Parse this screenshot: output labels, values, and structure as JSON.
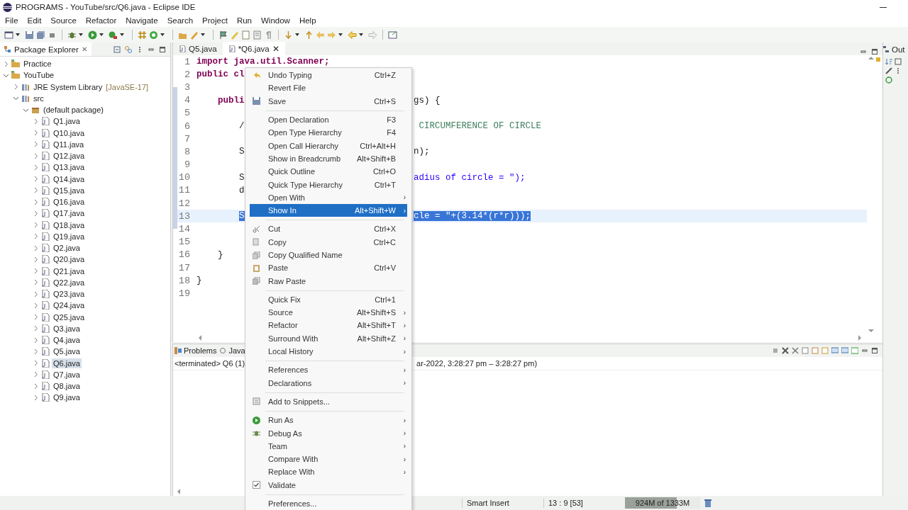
{
  "window": {
    "title": "PROGRAMS - YouTube/src/Q6.java - Eclipse IDE"
  },
  "menubar": [
    "File",
    "Edit",
    "Source",
    "Refactor",
    "Navigate",
    "Search",
    "Project",
    "Run",
    "Window",
    "Help"
  ],
  "package_explorer": {
    "tab": {
      "label": "Package Explorer",
      "close": "✕",
      "selected": true
    },
    "tree": [
      {
        "label": "Practice",
        "expanded": false
      },
      {
        "label": "YouTube",
        "expanded": true,
        "children": [
          {
            "label": "JRE System Library",
            "decoration": "[JavaSE-17]",
            "expanded": false
          },
          {
            "label": "src",
            "expanded": true,
            "children": [
              {
                "label": "(default package)",
                "expanded": true,
                "children": [
                  {
                    "label": "Q1.java",
                    "expanded": false,
                    "selected": false
                  },
                  {
                    "label": "Q10.java",
                    "expanded": false,
                    "selected": false
                  },
                  {
                    "label": "Q11.java",
                    "expanded": false,
                    "selected": false
                  },
                  {
                    "label": "Q12.java",
                    "expanded": false,
                    "selected": false
                  },
                  {
                    "label": "Q13.java",
                    "expanded": false,
                    "selected": false
                  },
                  {
                    "label": "Q14.java",
                    "expanded": false,
                    "selected": false
                  },
                  {
                    "label": "Q15.java",
                    "expanded": false,
                    "selected": false
                  },
                  {
                    "label": "Q16.java",
                    "expanded": false,
                    "selected": false
                  },
                  {
                    "label": "Q17.java",
                    "expanded": false,
                    "selected": false
                  },
                  {
                    "label": "Q18.java",
                    "expanded": false,
                    "selected": false
                  },
                  {
                    "label": "Q19.java",
                    "expanded": false,
                    "selected": false
                  },
                  {
                    "label": "Q2.java",
                    "expanded": false,
                    "selected": false
                  },
                  {
                    "label": "Q20.java",
                    "expanded": false,
                    "selected": false
                  },
                  {
                    "label": "Q21.java",
                    "expanded": false,
                    "selected": false
                  },
                  {
                    "label": "Q22.java",
                    "expanded": false,
                    "selected": false
                  },
                  {
                    "label": "Q23.java",
                    "expanded": false,
                    "selected": false
                  },
                  {
                    "label": "Q24.java",
                    "expanded": false,
                    "selected": false
                  },
                  {
                    "label": "Q25.java",
                    "expanded": false,
                    "selected": false
                  },
                  {
                    "label": "Q3.java",
                    "expanded": false,
                    "selected": false
                  },
                  {
                    "label": "Q4.java",
                    "expanded": false,
                    "selected": false
                  },
                  {
                    "label": "Q5.java",
                    "expanded": false,
                    "selected": false
                  },
                  {
                    "label": "Q6.java",
                    "expanded": false,
                    "selected": true
                  },
                  {
                    "label": "Q7.java",
                    "expanded": false,
                    "selected": false
                  },
                  {
                    "label": "Q8.java",
                    "expanded": false,
                    "selected": false
                  },
                  {
                    "label": "Q9.java",
                    "expanded": false,
                    "selected": false
                  }
                ]
              }
            ]
          }
        ]
      }
    ]
  },
  "editor": {
    "tabs": [
      {
        "label": "Q5.java",
        "selected": false
      },
      {
        "label": "*Q6.java",
        "close": "✕",
        "selected": true
      }
    ],
    "lines": [
      {
        "number": "1",
        "left": "import java.util.Scanner;",
        "selected": false
      },
      {
        "number": "2",
        "left": "public cl",
        "selected": false
      },
      {
        "number": "3",
        "selected": false
      },
      {
        "number": "4",
        "left": "    publi",
        "right": "gs) {",
        "selected": false
      },
      {
        "number": "5",
        "selected": false
      },
      {
        "number": "6",
        "left": "        /",
        "right": " CIRCUMFERENCE OF CIRCLE",
        "kind": "comment",
        "selected": false
      },
      {
        "number": "7",
        "selected": false
      },
      {
        "number": "8",
        "left": "        S",
        "right": "n);",
        "selected": false
      },
      {
        "number": "9",
        "selected": false
      },
      {
        "number": "10",
        "left": "        S",
        "right": "adius of circle = \");",
        "kind": "string",
        "selected": false
      },
      {
        "number": "11",
        "left": "        d",
        "selected": false
      },
      {
        "number": "12",
        "selected": false
      },
      {
        "number": "13",
        "left": "        S",
        "right": "cle = \"+(3.14*(r*r)));",
        "selected": true
      },
      {
        "number": "14",
        "selected": false
      },
      {
        "number": "15",
        "selected": false
      },
      {
        "number": "16",
        "left": "    }",
        "selected": false
      },
      {
        "number": "17",
        "selected": false
      },
      {
        "number": "18",
        "left": "}",
        "selected": false
      },
      {
        "number": "19",
        "selected": false
      }
    ]
  },
  "context_menu": {
    "groups": [
      [
        {
          "label": "Undo Typing",
          "shortcut": "Ctrl+Z",
          "selected": false
        },
        {
          "label": "Revert File",
          "selected": false
        },
        {
          "label": "Save",
          "shortcut": "Ctrl+S",
          "selected": false
        }
      ],
      [
        {
          "label": "Open Declaration",
          "shortcut": "F3",
          "selected": false
        },
        {
          "label": "Open Type Hierarchy",
          "shortcut": "F4",
          "selected": false
        },
        {
          "label": "Open Call Hierarchy",
          "shortcut": "Ctrl+Alt+H",
          "selected": false
        },
        {
          "label": "Show in Breadcrumb",
          "shortcut": "Alt+Shift+B",
          "selected": false
        },
        {
          "label": "Quick Outline",
          "shortcut": "Ctrl+O",
          "selected": false
        },
        {
          "label": "Quick Type Hierarchy",
          "shortcut": "Ctrl+T",
          "selected": false
        },
        {
          "label": "Open With",
          "arrow": "›",
          "selected": false
        },
        {
          "label": "Show In",
          "shortcut": "Alt+Shift+W",
          "arrow": "›",
          "selected": true
        }
      ],
      [
        {
          "label": "Cut",
          "shortcut": "Ctrl+X",
          "selected": false
        },
        {
          "label": "Copy",
          "shortcut": "Ctrl+C",
          "selected": false
        },
        {
          "label": "Copy Qualified Name",
          "selected": false
        },
        {
          "label": "Paste",
          "shortcut": "Ctrl+V",
          "selected": false
        },
        {
          "label": "Raw Paste",
          "selected": false
        }
      ],
      [
        {
          "label": "Quick Fix",
          "shortcut": "Ctrl+1",
          "selected": false
        },
        {
          "label": "Source",
          "shortcut": "Alt+Shift+S",
          "arrow": "›",
          "selected": false
        },
        {
          "label": "Refactor",
          "shortcut": "Alt+Shift+T",
          "arrow": "›",
          "selected": false
        },
        {
          "label": "Surround With",
          "shortcut": "Alt+Shift+Z",
          "arrow": "›",
          "selected": false
        },
        {
          "label": "Local History",
          "arrow": "›",
          "selected": false
        }
      ],
      [
        {
          "label": "References",
          "arrow": "›",
          "selected": false
        },
        {
          "label": "Declarations",
          "arrow": "›",
          "selected": false
        }
      ],
      [
        {
          "label": "Add to Snippets...",
          "selected": false
        }
      ],
      [
        {
          "label": "Run As",
          "arrow": "›",
          "selected": false
        },
        {
          "label": "Debug As",
          "arrow": "›",
          "selected": false
        },
        {
          "label": "Team",
          "arrow": "›",
          "selected": false
        },
        {
          "label": "Compare With",
          "arrow": "›",
          "selected": false
        },
        {
          "label": "Replace With",
          "arrow": "›",
          "selected": false
        },
        {
          "label": "Validate",
          "selected": false,
          "checked": true
        }
      ],
      [
        {
          "label": "Preferences...",
          "selected": false
        }
      ]
    ]
  },
  "console": {
    "tabs": [
      {
        "label": "Problems",
        "selected": false
      },
      {
        "label": "Java",
        "selected": false
      }
    ],
    "status_left": "<terminated> Q6 (1)",
    "status_right": "ar-2022, 3:28:27 pm – 3:28:27 pm)"
  },
  "outline": {
    "tab": {
      "label": "Out"
    }
  },
  "status_bar": {
    "insert_mode": "Smart Insert",
    "position": "13 : 9 [53]",
    "heap": {
      "text": "924M of 1333M",
      "level": 0.69
    }
  }
}
